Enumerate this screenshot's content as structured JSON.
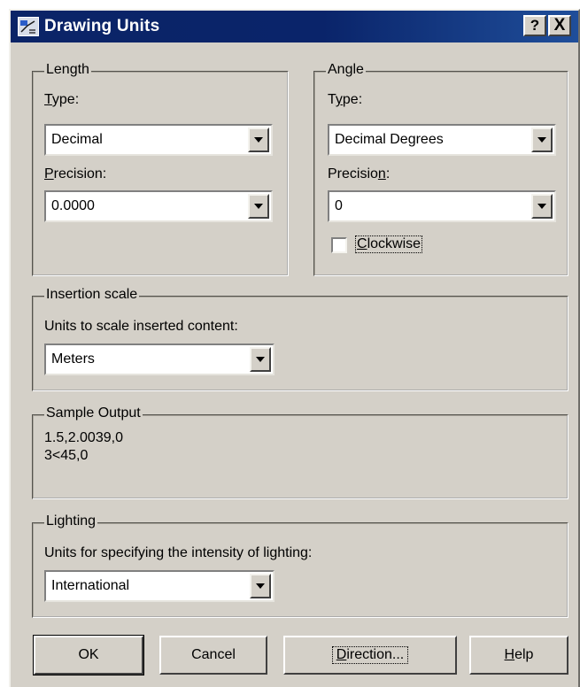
{
  "window": {
    "title": "Drawing Units",
    "help_glyph": "?",
    "close_glyph": "X"
  },
  "length": {
    "legend": "Length",
    "type_label": "Type:",
    "type_value": "Decimal",
    "precision_label": "Precision:",
    "precision_value": "0.0000"
  },
  "angle": {
    "legend": "Angle",
    "type_label": "Type:",
    "type_value": "Decimal Degrees",
    "precision_label": "Precision:",
    "precision_value": "0",
    "clockwise_label": "Clockwise",
    "clockwise_checked": false
  },
  "insertion": {
    "legend": "Insertion scale",
    "label": "Units to scale inserted content:",
    "value": "Meters"
  },
  "sample": {
    "legend": "Sample Output",
    "line1": "1.5,2.0039,0",
    "line2": "3<45,0"
  },
  "lighting": {
    "legend": "Lighting",
    "label": "Units for specifying the intensity of lighting:",
    "value": "International"
  },
  "buttons": {
    "ok": "OK",
    "cancel": "Cancel",
    "direction": "Direction...",
    "help": "Help"
  },
  "icons": {
    "app": "drawing-units-icon",
    "dropdown": "chevron-down-icon"
  }
}
